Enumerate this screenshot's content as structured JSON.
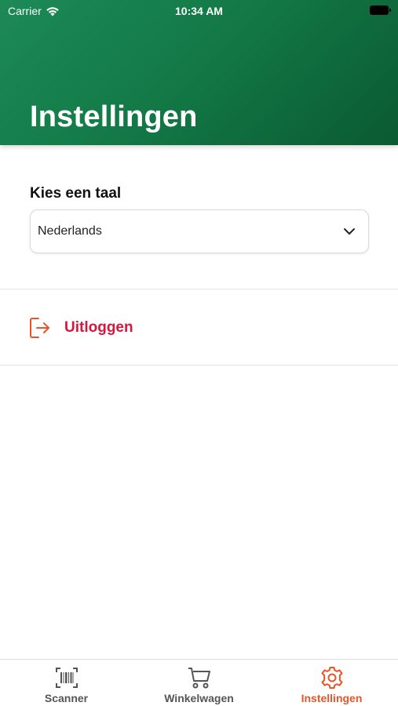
{
  "status_bar": {
    "carrier": "Carrier",
    "time": "10:34 AM"
  },
  "header": {
    "title": "Instellingen"
  },
  "language": {
    "label": "Kies een taal",
    "selected": "Nederlands",
    "icon": "chevron-down-icon"
  },
  "logout": {
    "label": "Uitloggen",
    "icon": "logout-icon",
    "color": "#d6173b"
  },
  "tabs": [
    {
      "label": "Scanner",
      "icon": "barcode-icon",
      "active": false
    },
    {
      "label": "Winkelwagen",
      "icon": "cart-icon",
      "active": false
    },
    {
      "label": "Instellingen",
      "icon": "gear-icon",
      "active": true
    }
  ],
  "colors": {
    "header_green": "#137a47",
    "accent_orange": "#e8542a",
    "logout_red": "#d6173b"
  }
}
